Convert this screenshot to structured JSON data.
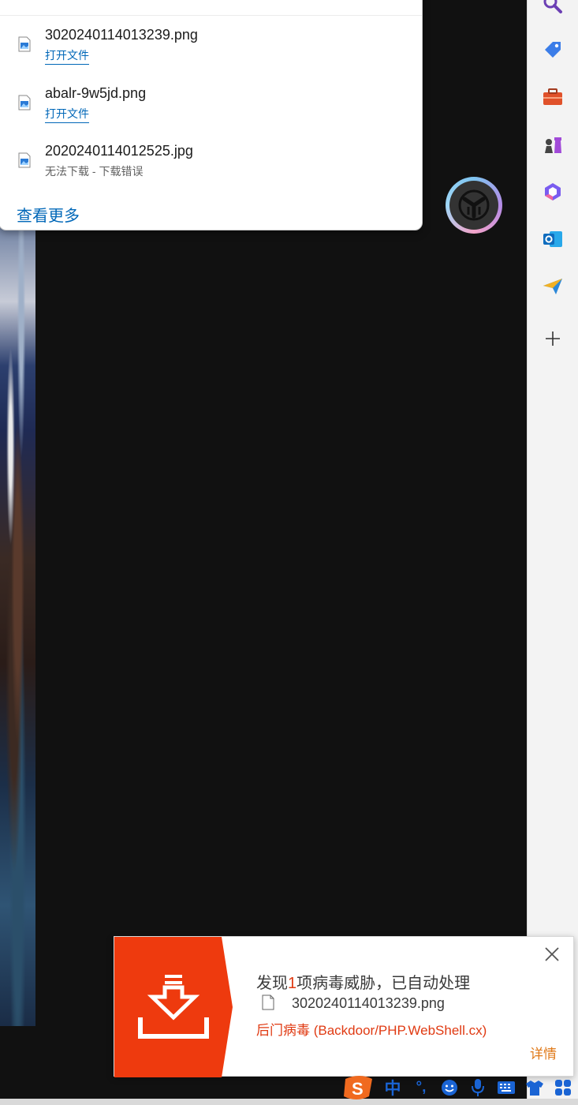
{
  "downloads": {
    "items": [
      {
        "filename": "3020240114013239.png",
        "action": "打开文件"
      },
      {
        "filename": "abalr-9w5jd.png",
        "action": "打开文件"
      },
      {
        "filename": "2020240114012525.jpg",
        "status": "无法下载 - 下载错误"
      }
    ],
    "see_more": "查看更多"
  },
  "sidebar": {
    "icons": [
      "search-icon",
      "shopping-tag-icon",
      "tools-briefcase-icon",
      "games-chess-icon",
      "copilot-icon",
      "outlook-icon",
      "send-icon",
      "add-icon"
    ]
  },
  "notification": {
    "title_prefix": "发现",
    "title_count": "1",
    "title_suffix": "项病毒威胁，已自动处理",
    "filename": "3020240114013239.png",
    "threat": "后门病毒 (Backdoor/PHP.WebShell.cx)",
    "detail": "详情"
  },
  "ime": {
    "mode": "中",
    "punct": "°,"
  },
  "colors": {
    "accent_blue": "#0067b8",
    "alert_red": "#ee3a0e",
    "detail_orange": "#e07a1a"
  }
}
